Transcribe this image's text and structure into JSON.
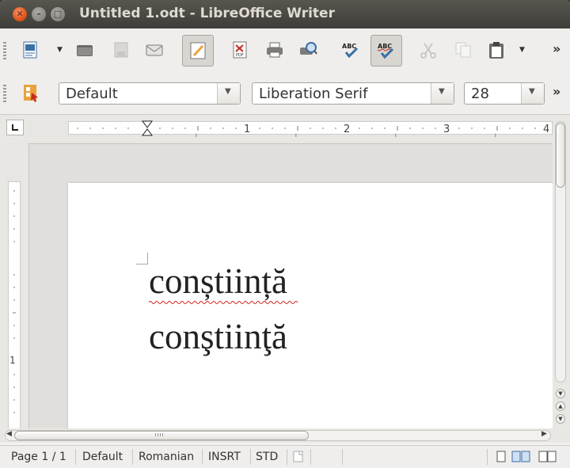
{
  "window": {
    "title": "Untitled 1.odt - LibreOffice Writer"
  },
  "toolbar": {
    "buttons": [
      "new-document",
      "open",
      "save",
      "email",
      "edit-file",
      "export-pdf",
      "print",
      "print-preview",
      "spelling",
      "auto-spellcheck",
      "cut",
      "copy",
      "paste"
    ],
    "more": "»"
  },
  "formatting": {
    "style": "Default",
    "font_name": "Liberation Serif",
    "font_size": "28",
    "more": "»"
  },
  "ruler": {
    "labels": [
      "1",
      "2",
      "3",
      "4"
    ],
    "vertical_label": "1"
  },
  "document": {
    "line1": "conștiință",
    "line2": "conştiinţă"
  },
  "statusbar": {
    "page": "Page 1 / 1",
    "style": "Default",
    "language": "Romanian",
    "insert_mode": "INSRT",
    "selection_mode": "STD"
  }
}
